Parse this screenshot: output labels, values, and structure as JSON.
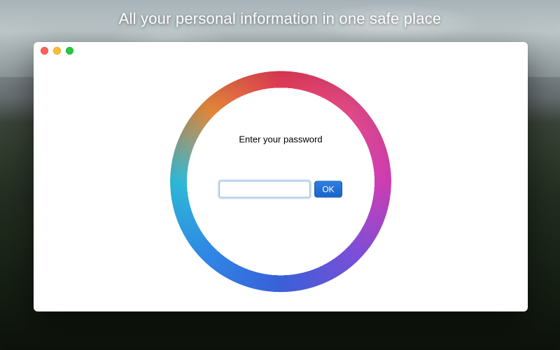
{
  "tagline": "All your personal information in one safe place",
  "login": {
    "prompt": "Enter your password",
    "password_value": "",
    "password_placeholder": "",
    "ok_label": "OK"
  },
  "window_controls": {
    "close": "close",
    "minimize": "minimize",
    "zoom": "zoom"
  }
}
